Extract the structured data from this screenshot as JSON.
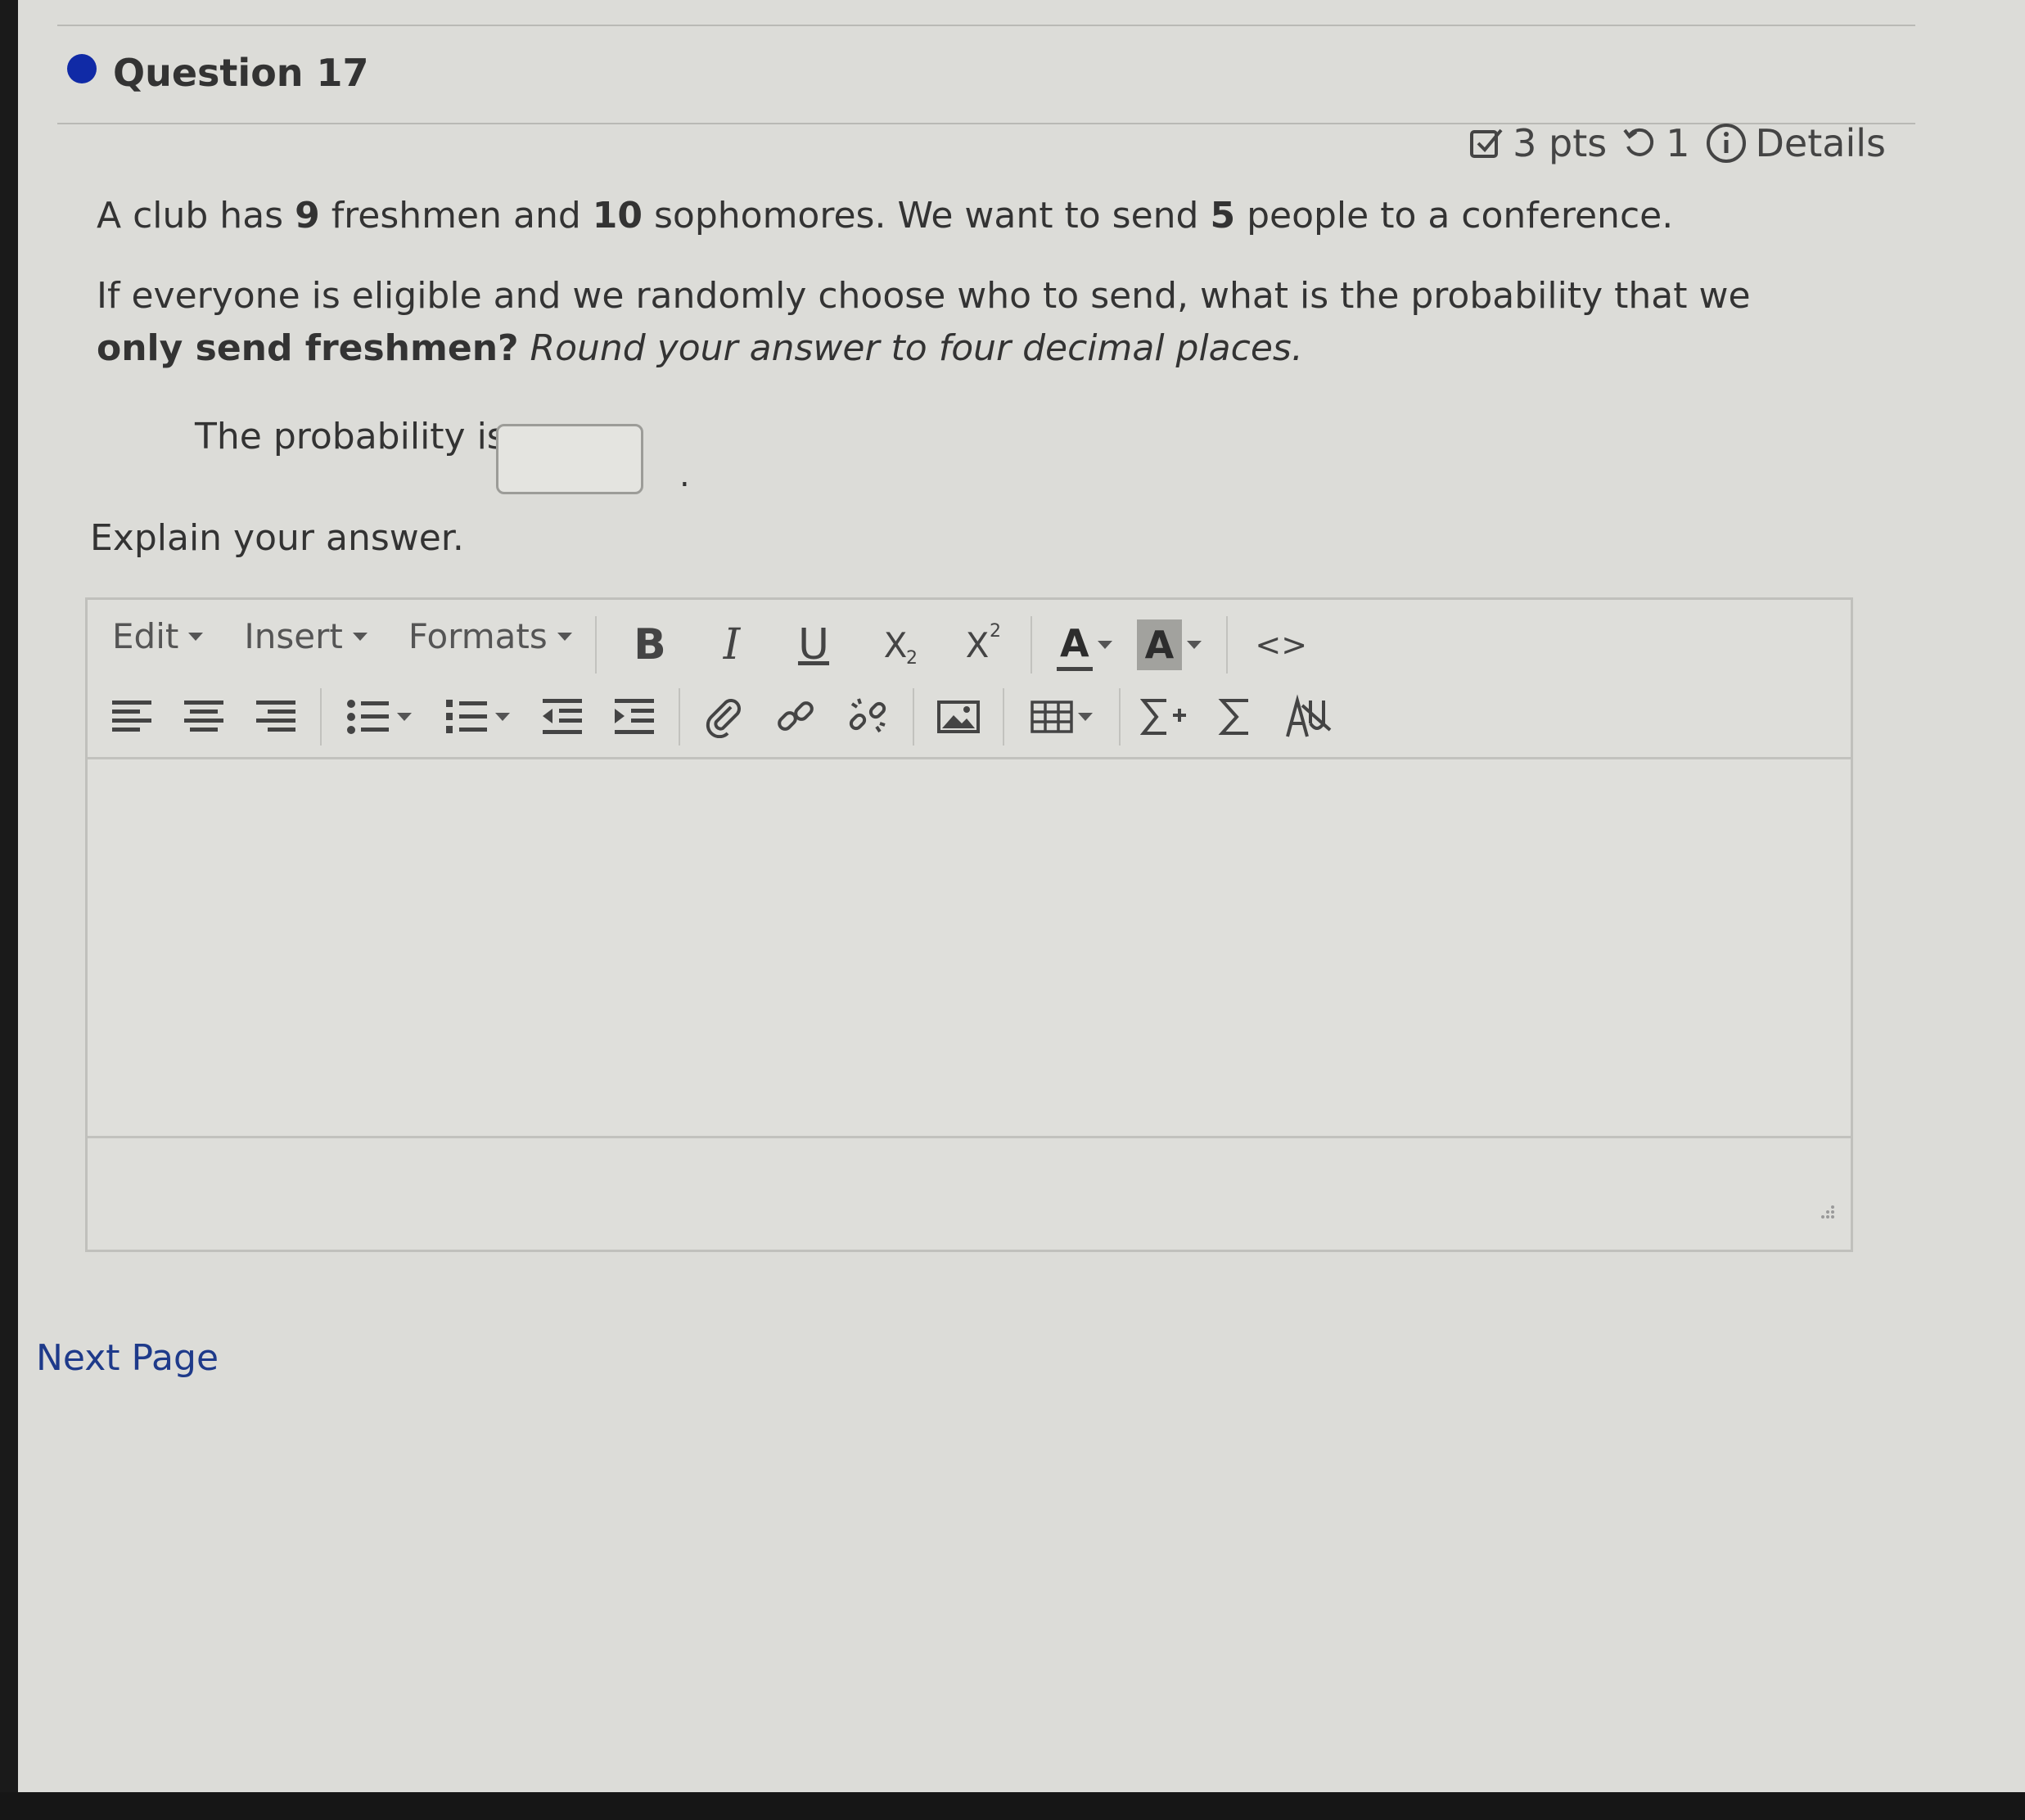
{
  "question": {
    "title": "Question 17",
    "points": "3 pts",
    "attempts": "1",
    "details_label": "Details"
  },
  "body": {
    "p1": {
      "t1": "A club has ",
      "n1": "9",
      "t2": " freshmen and ",
      "n2": "10",
      "t3": " sophomores.  We want to send ",
      "n3": "5",
      "t4": " people to a conference."
    },
    "p2": {
      "t1": "If everyone is eligible and we randomly choose who to send, what is the probability that we ",
      "b1": "only send freshmen?",
      "i1": " Round your answer to four decimal places."
    },
    "answer_label": "The probability is",
    "answer_value": "",
    "answer_suffix": ".",
    "explain_label": "Explain your answer."
  },
  "editor": {
    "menus": [
      "Edit",
      "Insert",
      "Formats"
    ],
    "bold": "B",
    "italic": "I",
    "underline": "U",
    "subscript": "X",
    "subscript_mark": "2",
    "superscript": "X",
    "superscript_mark": "2",
    "text_color": "A",
    "bg_color": "A",
    "source": "<>",
    "content": ""
  },
  "footer": {
    "next_page": "Next Page"
  },
  "colors": {
    "question_dot": "#102aa6",
    "link": "#1e3a8a"
  }
}
